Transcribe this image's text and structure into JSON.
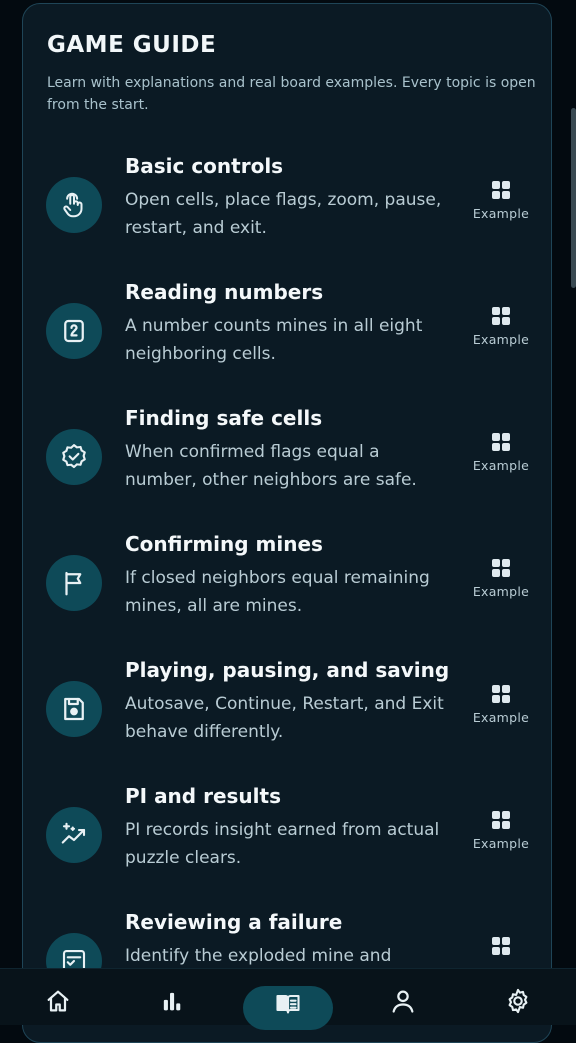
{
  "guide": {
    "title": "GAME GUIDE",
    "subtitle": "Learn with explanations and real board examples. Every topic is open from the start."
  },
  "topics": [
    {
      "title": "Basic controls",
      "description": "Open cells, place flags, zoom, pause, restart, and exit.",
      "icon": "tap-gesture-icon",
      "example_label": "Example"
    },
    {
      "title": "Reading numbers",
      "description": "A number counts mines in all eight neighboring cells.",
      "icon": "number-two-box-icon",
      "example_label": "Example"
    },
    {
      "title": "Finding safe cells",
      "description": "When confirmed flags equal a number, other neighbors are safe.",
      "icon": "verified-badge-icon",
      "example_label": "Example"
    },
    {
      "title": "Confirming mines",
      "description": "If closed neighbors equal remaining mines, all are mines.",
      "icon": "flag-icon",
      "example_label": "Example"
    },
    {
      "title": "Playing, pausing, and saving",
      "description": "Autosave, Continue, Restart, and Exit behave differently.",
      "icon": "save-icon",
      "example_label": "Example"
    },
    {
      "title": "PI and results",
      "description": "PI records insight earned from actual puzzle clears.",
      "icon": "sparkle-trend-icon",
      "example_label": "Example"
    },
    {
      "title": "Reviewing a failure",
      "description": "Identify the exploded mine and",
      "icon": "checklist-icon",
      "example_label": ""
    }
  ],
  "nav": {
    "items": [
      "home-icon",
      "stats-bar-icon",
      "guide-book-icon",
      "profile-icon",
      "settings-gear-icon"
    ],
    "active": "guide-book-icon"
  },
  "colors": {
    "accent": "#0e4a58",
    "panel": "#0b1a24",
    "background": "#030a10"
  }
}
